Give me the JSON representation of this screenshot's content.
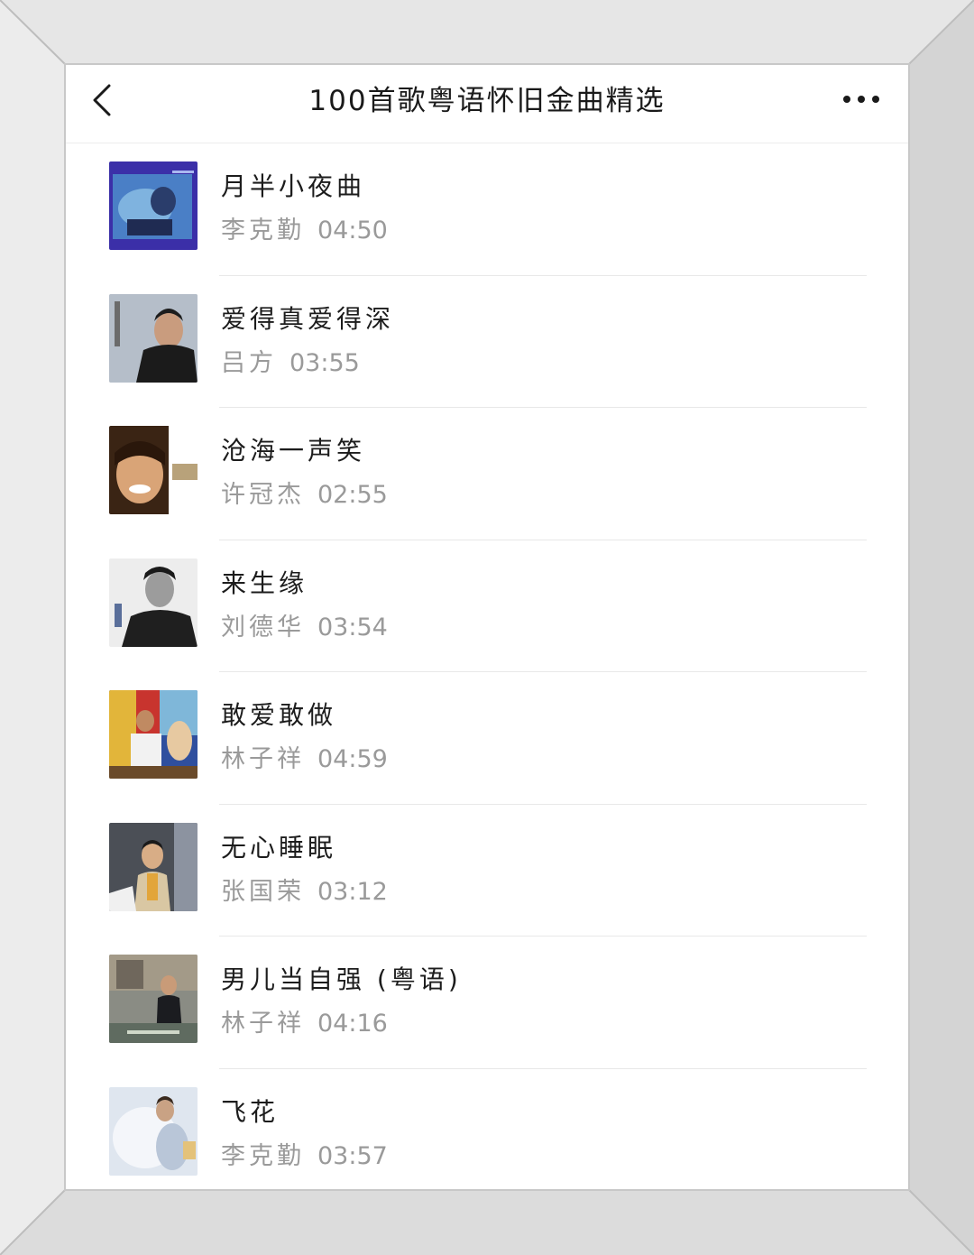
{
  "nav": {
    "title": "100首歌粤语怀旧金曲精选",
    "back_icon": "chevron-left-icon",
    "more_icon": "more-dots-icon"
  },
  "songs": [
    {
      "title": "月半小夜曲",
      "artist": "李克勤",
      "duration": "04:50"
    },
    {
      "title": "爱得真爱得深",
      "artist": "吕方",
      "duration": "03:55"
    },
    {
      "title": "沧海一声笑",
      "artist": "许冠杰",
      "duration": "02:55"
    },
    {
      "title": "来生缘",
      "artist": "刘德华",
      "duration": "03:54"
    },
    {
      "title": "敢爱敢做",
      "artist": "林子祥",
      "duration": "04:59"
    },
    {
      "title": "无心睡眠",
      "artist": "张国荣",
      "duration": "03:12"
    },
    {
      "title": "男儿当自强 (粤语)",
      "artist": "林子祥",
      "duration": "04:16"
    },
    {
      "title": "飞花",
      "artist": "李克勤",
      "duration": "03:57"
    }
  ],
  "colors": {
    "title": "#1c1c1c",
    "meta": "#9a9a9a",
    "divider": "#e8e8e8",
    "background": "#ffffff",
    "frame": "#d9d9d9"
  }
}
